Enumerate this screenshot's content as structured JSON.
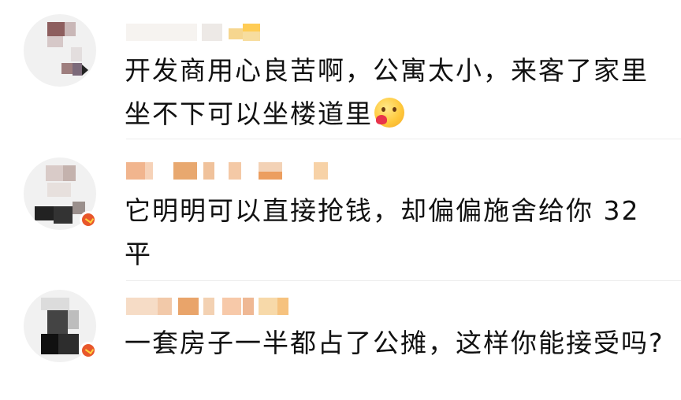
{
  "comments": [
    {
      "text": "开发商用心良苦啊，公寓太小，来客了家里坐不下可以坐楼道里",
      "emoji": "smiling-face-with-heart-emoji"
    },
    {
      "text": "它明明可以直接抢钱，却偏偏施舍给你 32 平"
    },
    {
      "text": "一套房子一半都占了公摊，这样你能接受吗?"
    }
  ],
  "colors": {
    "text": "#111111",
    "badge": "#e8572b",
    "username_blur": [
      "#f4c9a6",
      "#e9a46a",
      "#f7d9a9",
      "#ffb84a"
    ]
  }
}
